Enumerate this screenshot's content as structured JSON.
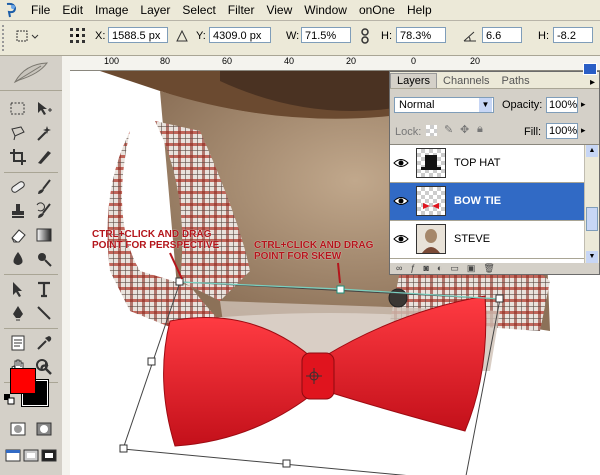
{
  "menubar": {
    "items": [
      "File",
      "Edit",
      "Image",
      "Layer",
      "Select",
      "Filter",
      "View",
      "Window",
      "onOne",
      "Help"
    ]
  },
  "options": {
    "x_label": "X:",
    "x_value": "1588.5 px",
    "y_label": "Y:",
    "y_value": "4309.0 px",
    "w_label": "W:",
    "w_value": "71.5%",
    "h_label": "H:",
    "h_value": "78.3%",
    "angle_value": "6.6",
    "hskew_label": "H:",
    "hskew_value": "-8.2"
  },
  "ruler": {
    "top": [
      "100",
      "80",
      "60",
      "40",
      "20",
      "0",
      "20"
    ]
  },
  "layers_panel": {
    "tabs": [
      "Layers",
      "Channels",
      "Paths"
    ],
    "blend_mode": "Normal",
    "opacity_label": "Opacity:",
    "opacity_value": "100%",
    "lock_label": "Lock:",
    "fill_label": "Fill:",
    "fill_value": "100%",
    "layers": [
      {
        "name": "TOP HAT",
        "selected": false
      },
      {
        "name": "BOW TIE",
        "selected": true
      },
      {
        "name": "STEVE",
        "selected": false
      }
    ]
  },
  "annotations": {
    "perspective": "CTRL+CLICK AND DRAG\nPOINT FOR PERSPECTIVE",
    "skew": "CTRL+CLICK AND DRAG\nPOINT FOR SKEW"
  },
  "colors": {
    "foreground": "#ff0000",
    "background": "#000000",
    "selection": "#316ac5"
  }
}
